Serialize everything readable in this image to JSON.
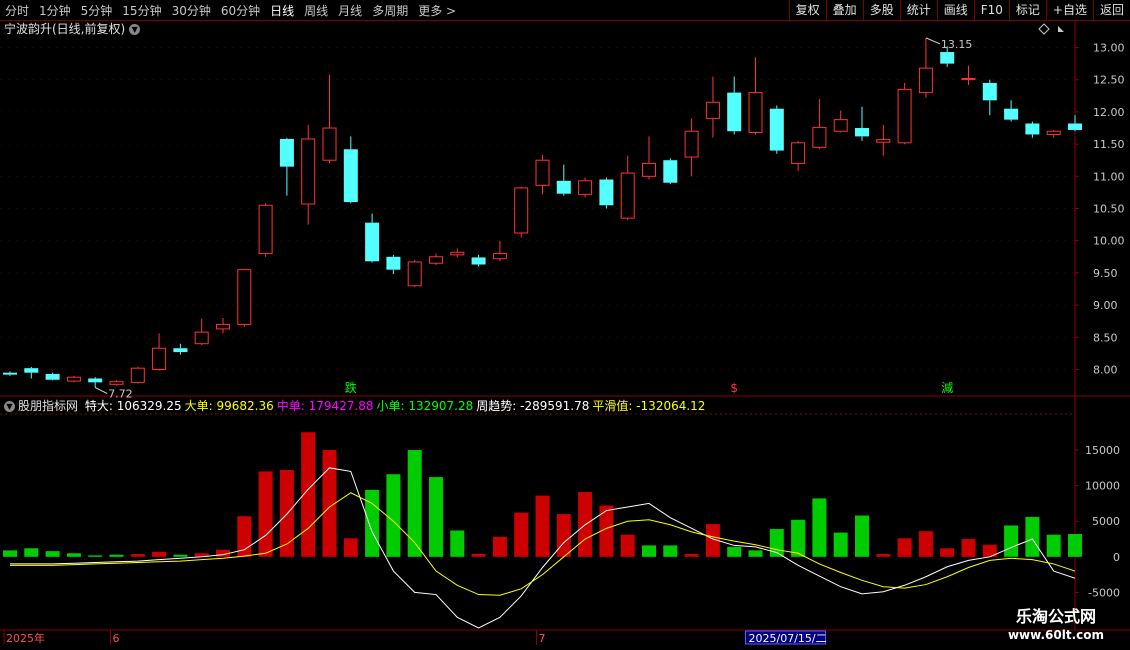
{
  "toolbar": {
    "tabs": [
      "分时",
      "1分钟",
      "5分钟",
      "15分钟",
      "30分钟",
      "60分钟",
      "日线",
      "周线",
      "月线",
      "多周期",
      "更多 >"
    ],
    "active_tab": "日线",
    "tools": [
      "复权",
      "叠加",
      "多股",
      "统计",
      "画线",
      "F10",
      "标记",
      "+自选",
      "返回"
    ]
  },
  "stock_title": "宁波韵升(日线,前复权)",
  "indicator": {
    "name": "股朋指标网",
    "items": [
      {
        "label": "特大:",
        "value": "106329.25",
        "color": "#ffffff"
      },
      {
        "label": "大单:",
        "value": "99682.36",
        "color": "#ffff00"
      },
      {
        "label": "中单:",
        "value": "179427.88",
        "color": "#ff00ff"
      },
      {
        "label": "小单:",
        "value": "132907.28",
        "color": "#00ff00"
      },
      {
        "label": "周趋势:",
        "value": "-289591.78",
        "color": "#ffffff"
      },
      {
        "label": "平滑值:",
        "value": "-132064.12",
        "color": "#ffff00"
      }
    ]
  },
  "watermark": {
    "line1": "乐淘公式网",
    "line2": "www.60lt.com"
  },
  "colors": {
    "up": "#ff3232",
    "down": "#54ffff",
    "vol_red": "#cc0000",
    "vol_green": "#00cc00",
    "axis": "#8b0000"
  },
  "chart_data": [
    {
      "type": "candlestick",
      "y_ticks": [
        "13.00",
        "12.50",
        "12.00",
        "11.50",
        "11.00",
        "10.50",
        "10.00",
        "9.50",
        "9.00",
        "8.50",
        "8.00"
      ],
      "ylim": [
        7.65,
        13.35
      ],
      "max_label": "13.15",
      "min_label": "7.72",
      "markers": [
        {
          "index": 16,
          "text": "跌",
          "color": "#00ff00"
        },
        {
          "index": 34,
          "text": "$",
          "color": "#ff3333"
        },
        {
          "index": 44,
          "text": "減",
          "color": "#00ff00"
        }
      ],
      "candles": [
        {
          "o": 7.95,
          "c": 7.92,
          "h": 7.97,
          "l": 7.9
        },
        {
          "o": 8.02,
          "c": 7.95,
          "h": 8.04,
          "l": 7.86
        },
        {
          "o": 7.93,
          "c": 7.84,
          "h": 7.95,
          "l": 7.83
        },
        {
          "o": 7.82,
          "c": 7.88,
          "h": 7.9,
          "l": 7.8
        },
        {
          "o": 7.86,
          "c": 7.8,
          "h": 7.88,
          "l": 7.72
        },
        {
          "o": 7.77,
          "c": 7.81,
          "h": 7.83,
          "l": 7.75
        },
        {
          "o": 7.8,
          "c": 8.02,
          "h": 8.04,
          "l": 7.78
        },
        {
          "o": 8.0,
          "c": 8.33,
          "h": 8.56,
          "l": 7.98
        },
        {
          "o": 8.33,
          "c": 8.27,
          "h": 8.4,
          "l": 8.23
        },
        {
          "o": 8.4,
          "c": 8.58,
          "h": 8.79,
          "l": 8.38
        },
        {
          "o": 8.63,
          "c": 8.7,
          "h": 8.8,
          "l": 8.56
        },
        {
          "o": 8.7,
          "c": 9.55,
          "h": 9.56,
          "l": 8.66
        },
        {
          "o": 9.8,
          "c": 10.55,
          "h": 10.58,
          "l": 9.75
        },
        {
          "o": 11.58,
          "c": 11.15,
          "h": 11.6,
          "l": 10.7
        },
        {
          "o": 10.57,
          "c": 11.58,
          "h": 11.8,
          "l": 10.25
        },
        {
          "o": 11.25,
          "c": 11.75,
          "h": 12.58,
          "l": 11.2
        },
        {
          "o": 11.42,
          "c": 10.6,
          "h": 11.62,
          "l": 10.58
        },
        {
          "o": 10.28,
          "c": 9.68,
          "h": 10.42,
          "l": 9.66
        },
        {
          "o": 9.75,
          "c": 9.55,
          "h": 9.78,
          "l": 9.48
        },
        {
          "o": 9.3,
          "c": 9.67,
          "h": 9.7,
          "l": 9.28
        },
        {
          "o": 9.65,
          "c": 9.75,
          "h": 9.8,
          "l": 9.62
        },
        {
          "o": 9.78,
          "c": 9.82,
          "h": 9.88,
          "l": 9.74
        },
        {
          "o": 9.74,
          "c": 9.63,
          "h": 9.78,
          "l": 9.6
        },
        {
          "o": 9.72,
          "c": 9.8,
          "h": 10.0,
          "l": 9.68
        },
        {
          "o": 10.12,
          "c": 10.82,
          "h": 10.84,
          "l": 10.05
        },
        {
          "o": 10.86,
          "c": 11.25,
          "h": 11.33,
          "l": 10.72
        },
        {
          "o": 10.93,
          "c": 10.73,
          "h": 11.18,
          "l": 10.7
        },
        {
          "o": 10.72,
          "c": 10.93,
          "h": 10.98,
          "l": 10.67
        },
        {
          "o": 10.95,
          "c": 10.55,
          "h": 10.98,
          "l": 10.5
        },
        {
          "o": 10.35,
          "c": 11.05,
          "h": 11.32,
          "l": 10.32
        },
        {
          "o": 11.0,
          "c": 11.2,
          "h": 11.62,
          "l": 10.95
        },
        {
          "o": 11.25,
          "c": 10.9,
          "h": 11.28,
          "l": 10.88
        },
        {
          "o": 11.3,
          "c": 11.7,
          "h": 11.9,
          "l": 11.0
        },
        {
          "o": 11.9,
          "c": 12.15,
          "h": 12.55,
          "l": 11.6
        },
        {
          "o": 12.3,
          "c": 11.7,
          "h": 12.55,
          "l": 11.65
        },
        {
          "o": 11.68,
          "c": 12.3,
          "h": 12.85,
          "l": 11.65
        },
        {
          "o": 12.05,
          "c": 11.4,
          "h": 12.1,
          "l": 11.35
        },
        {
          "o": 11.2,
          "c": 11.52,
          "h": 11.55,
          "l": 11.08
        },
        {
          "o": 11.45,
          "c": 11.76,
          "h": 12.2,
          "l": 11.42
        },
        {
          "o": 11.7,
          "c": 11.88,
          "h": 12.02,
          "l": 11.68
        },
        {
          "o": 11.75,
          "c": 11.62,
          "h": 12.08,
          "l": 11.55
        },
        {
          "o": 11.53,
          "c": 11.57,
          "h": 11.8,
          "l": 11.32
        },
        {
          "o": 11.52,
          "c": 12.35,
          "h": 12.45,
          "l": 11.5
        },
        {
          "o": 12.3,
          "c": 12.68,
          "h": 13.15,
          "l": 12.22
        },
        {
          "o": 12.93,
          "c": 12.75,
          "h": 13.02,
          "l": 12.7
        },
        {
          "o": 12.52,
          "c": 12.52,
          "h": 12.72,
          "l": 12.42
        },
        {
          "o": 12.45,
          "c": 12.18,
          "h": 12.5,
          "l": 11.95
        },
        {
          "o": 12.05,
          "c": 11.88,
          "h": 12.18,
          "l": 11.85
        },
        {
          "o": 11.82,
          "c": 11.65,
          "h": 11.85,
          "l": 11.6
        },
        {
          "o": 11.65,
          "c": 11.7,
          "h": 11.72,
          "l": 11.6
        },
        {
          "o": 11.82,
          "c": 11.72,
          "h": 11.95,
          "l": 11.7
        }
      ]
    },
    {
      "type": "bar+line",
      "y_ticks": [
        "15000",
        "10000",
        "5000",
        "0",
        "-5000"
      ],
      "ylim": [
        -10000,
        19500
      ],
      "bars": [
        900,
        1200,
        800,
        500,
        200,
        300,
        400,
        700,
        300,
        500,
        1000,
        5700,
        12000,
        12200,
        17500,
        15000,
        2600,
        9400,
        11600,
        15000,
        11200,
        3700,
        400,
        2800,
        6200,
        8600,
        6000,
        9100,
        7200,
        3100,
        1600,
        1600,
        400,
        4600,
        1400,
        900,
        3900,
        5200,
        8200,
        3400,
        5800,
        400,
        2600,
        3600,
        1200,
        2500,
        1700,
        4400,
        5600,
        3100,
        3200
      ],
      "bar_colors": [
        "g",
        "g",
        "g",
        "g",
        "g",
        "g",
        "r",
        "r",
        "g",
        "r",
        "r",
        "r",
        "r",
        "r",
        "r",
        "r",
        "r",
        "g",
        "g",
        "g",
        "g",
        "g",
        "r",
        "r",
        "r",
        "r",
        "r",
        "r",
        "r",
        "r",
        "g",
        "g",
        "r",
        "r",
        "g",
        "g",
        "g",
        "g",
        "g",
        "g",
        "g",
        "r",
        "r",
        "r",
        "r",
        "r",
        "r",
        "g",
        "g",
        "g",
        "g"
      ],
      "line_white": [
        -1000,
        -1000,
        -1000,
        -900,
        -800,
        -700,
        -600,
        -400,
        -200,
        0,
        300,
        1000,
        3000,
        6000,
        9500,
        12500,
        12000,
        3500,
        -2000,
        -5000,
        -5300,
        -8500,
        -10000,
        -8500,
        -5500,
        -1500,
        2000,
        4500,
        6500,
        7000,
        7500,
        5500,
        4000,
        2500,
        1600,
        1400,
        600,
        -1200,
        -2700,
        -4200,
        -5200,
        -4900,
        -4000,
        -2800,
        -1400,
        -500,
        0,
        1300,
        2500,
        -2000,
        -3000
      ],
      "line_yellow": [
        -1200,
        -1200,
        -1200,
        -1100,
        -1000,
        -900,
        -800,
        -700,
        -600,
        -400,
        -200,
        100,
        500,
        1800,
        4000,
        7000,
        9000,
        7500,
        5000,
        2000,
        -2000,
        -4000,
        -5300,
        -5400,
        -4500,
        -2500,
        0,
        2500,
        4000,
        5000,
        5200,
        4500,
        3500,
        2800,
        2200,
        1700,
        1000,
        500,
        -1000,
        -2200,
        -3300,
        -4200,
        -4400,
        -3900,
        -2800,
        -1500,
        -500,
        -200,
        -400,
        -1000,
        -2000
      ]
    }
  ],
  "time_axis": {
    "labels": [
      "2025年",
      "6",
      "7"
    ],
    "label_index": [
      0,
      5,
      25
    ],
    "highlight": "2025/07/15/二",
    "highlight_index": 35
  }
}
